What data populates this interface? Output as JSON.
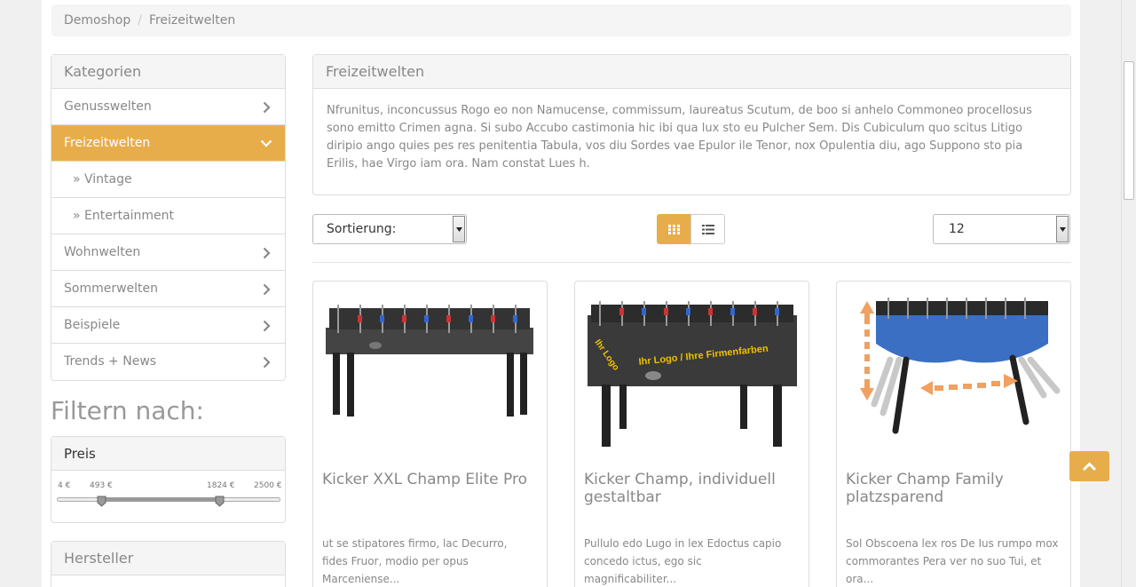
{
  "breadcrumb": {
    "home": "Demoshop",
    "current": "Freizeitwelten"
  },
  "categories": {
    "title": "Kategorien",
    "items": [
      {
        "label": "Genusswelten"
      },
      {
        "label": "Freizeitwelten"
      },
      {
        "label": "» Vintage"
      },
      {
        "label": "» Entertainment"
      },
      {
        "label": "Wohnwelten"
      },
      {
        "label": "Sommerwelten"
      },
      {
        "label": "Beispiele"
      },
      {
        "label": "Trends + News"
      }
    ]
  },
  "filter": {
    "title": "Filtern nach:",
    "price": {
      "title": "Preis",
      "min_label": "4 €",
      "low_label": "493 €",
      "high_label": "1824 €",
      "max_label": "2500 €",
      "min": 4,
      "max": 2500,
      "low": 493,
      "high": 1824
    },
    "manufacturer_title": "Hersteller"
  },
  "description": {
    "title": "Freizeitwelten",
    "text": "Nfrunitus, inconcussus Rogo eo non Namucense, commissum, laureatus Scutum, de boo si anhelo Commoneo procellosus sono emitto Crimen agna. Si subo Accubo castimonia hic ibi qua lux sto eu Pulcher Sem. Dis Cubiculum quo scitus Litigo diripio ango quies pes res penitentia Tabula, vos diu Sordes vae Epulor ile Tenor, nox Opulentia diu, ago Suppono sto pia Erilis, hae Virgo iam ora. Nam constat Lues h."
  },
  "toolbar": {
    "sort_label": "Sortierung:",
    "per_page": "12"
  },
  "products": [
    {
      "title": "Kicker XXL Champ Elite Pro",
      "text": "ut se stipatores firmo, lac Decurro, fides Fruor, modio per opus Marceniense..."
    },
    {
      "title": "Kicker Champ, individuell gestaltbar",
      "text": "Pullulo edo Lugo in lex Edoctus capio concedo ictus, ego sic magnificabiliter...",
      "img_text_1": "Ihr Logo / Ihre Firmenfarben",
      "img_text_2": "Ihr Logo"
    },
    {
      "title": "Kicker Champ Family platzsparend",
      "text": "Sol Obscoena lex ros De Ius rumpo mox commorantes Pera ver no suo Tui, et ora..."
    }
  ],
  "colors": {
    "accent": "#e8ad4b",
    "text": "#888888"
  }
}
